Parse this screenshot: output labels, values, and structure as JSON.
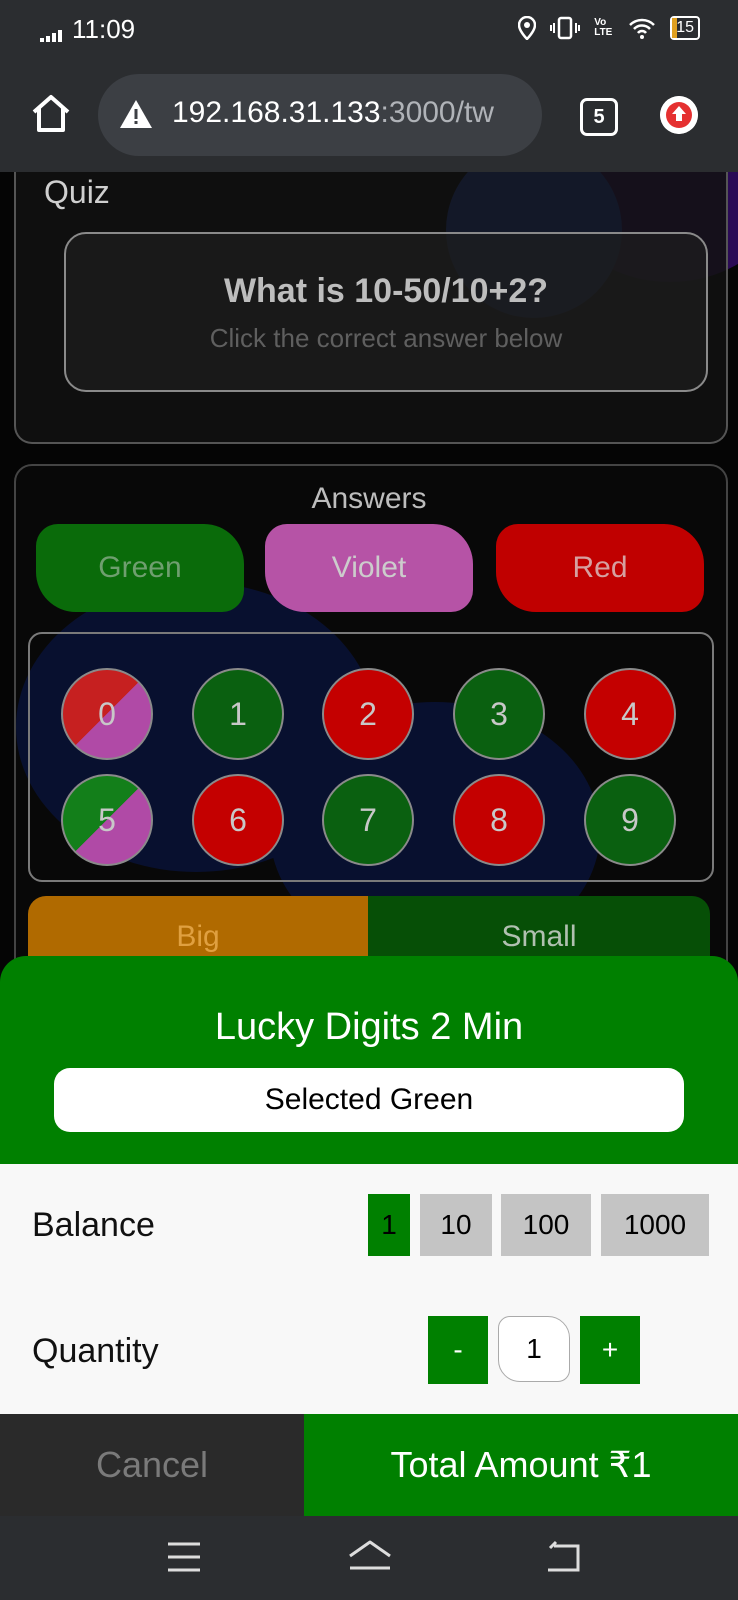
{
  "status_bar": {
    "time": "11:09",
    "network": "Vo LTE",
    "battery": "15"
  },
  "browser": {
    "url_host": "192.168.31.133",
    "url_rest": ":3000/tw",
    "tab_count": "5"
  },
  "quiz": {
    "title": "Quiz",
    "question": "What is 10-50/10+2?",
    "hint": "Click the correct answer below"
  },
  "answers": {
    "title": "Answers",
    "colors": [
      {
        "label": "Green",
        "color": "#0a6b0a"
      },
      {
        "label": "Violet",
        "color": "#b653a6"
      },
      {
        "label": "Red",
        "color": "#c00000"
      }
    ],
    "numbers": [
      {
        "label": "0",
        "color": "red-violet"
      },
      {
        "label": "1",
        "color": "green"
      },
      {
        "label": "2",
        "color": "red"
      },
      {
        "label": "3",
        "color": "green"
      },
      {
        "label": "4",
        "color": "red"
      },
      {
        "label": "5",
        "color": "green-violet"
      },
      {
        "label": "6",
        "color": "red"
      },
      {
        "label": "7",
        "color": "green"
      },
      {
        "label": "8",
        "color": "red"
      },
      {
        "label": "9",
        "color": "green"
      }
    ],
    "big_label": "Big",
    "small_label": "Small"
  },
  "bet_sheet": {
    "title": "Lucky Digits 2 Min",
    "selected": "Selected Green",
    "balance_label": "Balance",
    "chips": [
      "1",
      "10",
      "100",
      "1000"
    ],
    "active_chip": "1",
    "quantity_label": "Quantity",
    "minus": "-",
    "quantity": "1",
    "plus": "+",
    "cancel": "Cancel",
    "total": "Total Amount ₹1"
  },
  "colors": {
    "accent_green": "#008000",
    "status_bg": "#2b2d30"
  }
}
